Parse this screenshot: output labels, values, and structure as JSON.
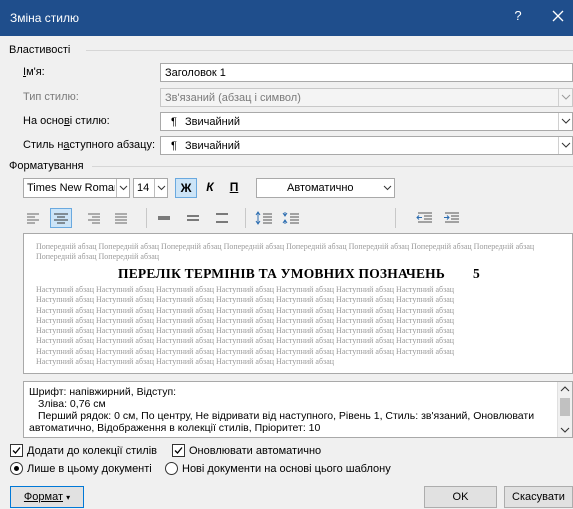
{
  "window": {
    "title": "Зміна стилю",
    "help": "?"
  },
  "properties": {
    "section": "Властивості",
    "name": {
      "label": "Ім'я:",
      "value": "Заголовок 1"
    },
    "style_type": {
      "label": "Тип стилю:",
      "value": "Зв'язаний (абзац і символ)"
    },
    "based_on": {
      "label": "На основі стилю:",
      "value": "Звичайний"
    },
    "next_style": {
      "label": "Стиль наступного абзацу:",
      "value": "Звичайний"
    }
  },
  "formatting": {
    "section": "Форматування",
    "font": "Times New Roman",
    "size": "14",
    "bold": "Ж",
    "italic": "К",
    "underline": "П",
    "color": "Автоматично"
  },
  "preview": {
    "previous_text": "Попередній абзац Попередній абзац Попередній абзац Попередній абзац Попередній абзац Попередній абзац Попередній абзац Попередній абзац Попередній абзац Попередній абзац",
    "heading": "ПЕРЕЛІК ТЕРМІНІВ ТА УМОВНИХ ПОЗНАЧЕНЬ",
    "heading_number": "5",
    "next_lines": [
      "Наступний абзац Наступний абзац Наступний абзац Наступний абзац Наступний абзац Наступний абзац Наступний абзац",
      "Наступний абзац Наступний абзац Наступний абзац Наступний абзац Наступний абзац Наступний абзац Наступний абзац",
      "Наступний абзац Наступний абзац Наступний абзац Наступний абзац Наступний абзац Наступний абзац Наступний абзац",
      "Наступний абзац Наступний абзац Наступний абзац Наступний абзац Наступний абзац Наступний абзац Наступний абзац",
      "Наступний абзац Наступний абзац Наступний абзац Наступний абзац Наступний абзац Наступний абзац Наступний абзац",
      "Наступний абзац Наступний абзац Наступний абзац Наступний абзац Наступний абзац Наступний абзац Наступний абзац",
      "Наступний абзац Наступний абзац Наступний абзац Наступний абзац Наступний абзац Наступний абзац Наступний абзац",
      "Наступний абзац Наступний абзац Наступний абзац Наступний абзац Наступний абзац"
    ]
  },
  "description": {
    "line1": "Шрифт: напівжирний, Відступ:",
    "line2": "Зліва:  0,76 см",
    "line3": "Перший рядок:  0 см, По центру, Не відривати від наступного, Рівень 1, Стиль: зв'язаний, Оновлювати",
    "line4": "автоматично, Відображення в колекції стилів, Пріоритет: 10"
  },
  "options": {
    "add_to_gallery": "Додати до колекції стилів",
    "auto_update": "Оновлювати автоматично",
    "only_this_doc": "Лише в цьому документі",
    "new_docs_template": "Нові документи на основі цього шаблону"
  },
  "buttons": {
    "format": "Формат",
    "ok": "OK",
    "cancel": "Скасувати"
  },
  "colors": {
    "titlebar": "#1f4e8c",
    "accent": "#0078d7"
  }
}
